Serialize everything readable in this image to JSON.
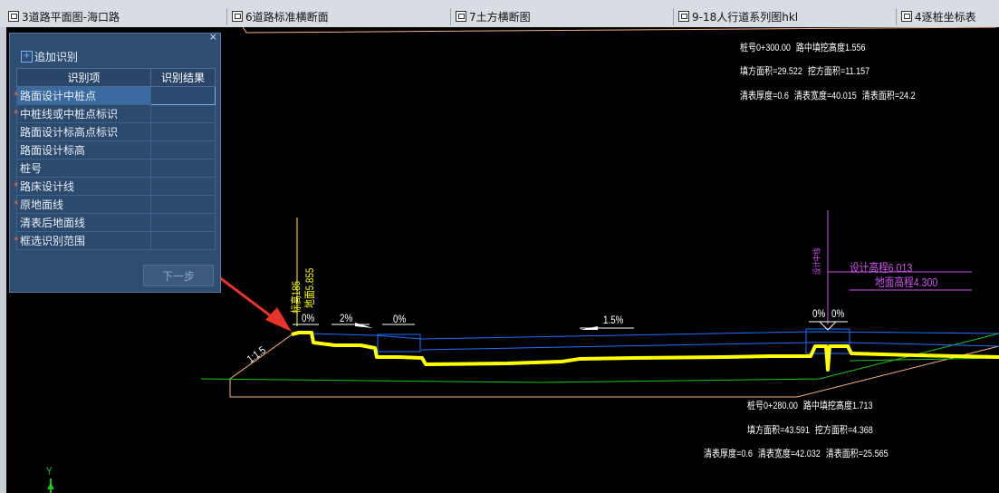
{
  "tabs": [
    {
      "label": "3道路平面图-海口路"
    },
    {
      "label": "6道路标准横断面"
    },
    {
      "label": "7土方横断图"
    },
    {
      "label": "9-18人行道系列图hkl"
    },
    {
      "label": "4逐桩坐标表"
    }
  ],
  "panel": {
    "close": "×",
    "add_label": "追加识别",
    "col_item": "识别项",
    "col_result": "识别结果",
    "rows": [
      {
        "label": "路面设计中桩点",
        "required": "*"
      },
      {
        "label": "中桩线或中桩点标识",
        "required": "*"
      },
      {
        "label": "路面设计标高点标识",
        "required": ""
      },
      {
        "label": "路面设计标高",
        "required": ""
      },
      {
        "label": "桩号",
        "required": ""
      },
      {
        "label": "路床设计线",
        "required": "*"
      },
      {
        "label": "原地面线",
        "required": "*"
      },
      {
        "label": "清表后地面线",
        "required": ""
      },
      {
        "label": "框选识别范围",
        "required": "*"
      }
    ],
    "next_label": "下一步"
  },
  "drawing": {
    "top_block": {
      "line1a": "桩号0+300.00",
      "line1b": "路中填挖高度1.556",
      "line2a": "填方面积=29.522",
      "line2b": "挖方面积=11.157",
      "line3a": "清表厚度=0.6",
      "line3b": "清表宽度=40.015",
      "line3c": "清表面积=24.2"
    },
    "bottom_block": {
      "line1a": "桩号0+280.00",
      "line1b": "路中填挖高度1.713",
      "line2a": "填方面积=43.591",
      "line2b": "挖方面积=4.368",
      "line3a": "清表厚度=0.6",
      "line3b": "清表宽度=42.032",
      "line3c": "清表面积=25.565"
    },
    "left_elev_a": "标高185",
    "left_elev_b": "地面5.855",
    "slope_left": "0%",
    "slope_2": "2%",
    "slope_0": "0%",
    "slope_15": "1.5%",
    "slope_r1": "0%",
    "slope_r2": "0%",
    "side_slope": "1:1.5",
    "design_elev": "设计高程6.013",
    "ground_elev": "地面高程4.300",
    "center_label": "设计中线",
    "axis_y": "Y",
    "colors": {
      "road": "#ffff00",
      "blue": "#1e6fff",
      "green": "#18c818",
      "magenta": "#cc55ee",
      "orange": "#ffb27a",
      "arrow": "#e8332a"
    }
  }
}
